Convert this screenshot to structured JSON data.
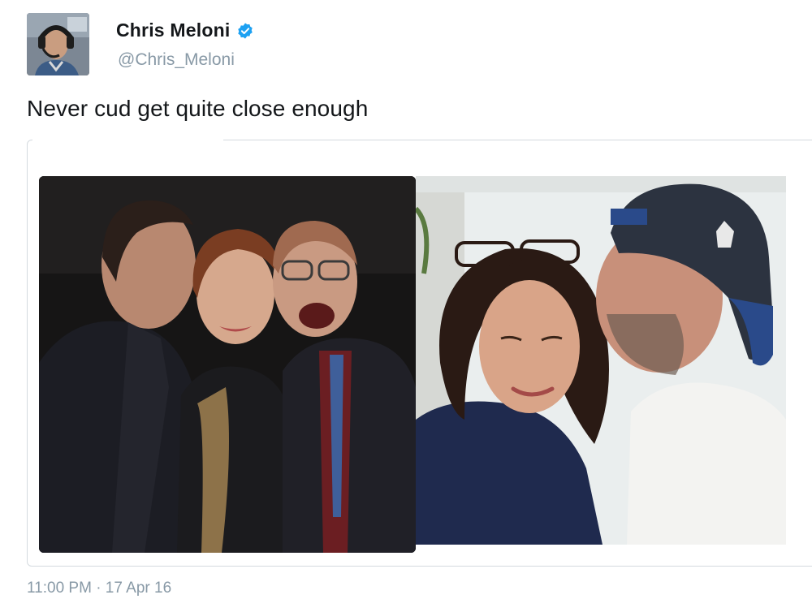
{
  "author": {
    "display_name": "Chris Meloni",
    "handle": "@Chris_Meloni",
    "verified": true,
    "avatar_icon": "profile-photo-pilot-headset"
  },
  "tweet": {
    "text": "Never cud get quite close enough",
    "timestamp": "11:00 PM · 17 Apr 16"
  },
  "media": {
    "photos": [
      {
        "icon": "photo-three-people-posing"
      },
      {
        "icon": "photo-man-kissing-woman-forehead"
      }
    ]
  },
  "colors": {
    "text": "#14171a",
    "secondary": "#8899a6",
    "verified_blue": "#1da1f2",
    "border": "#d4dadf"
  }
}
